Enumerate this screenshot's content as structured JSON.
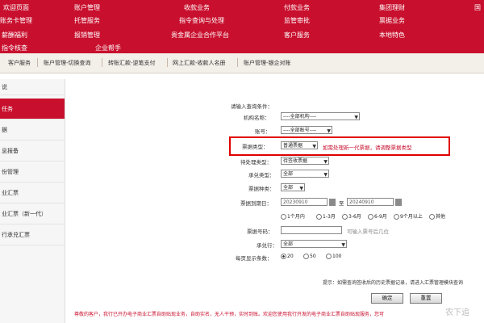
{
  "top_nav": {
    "row1": [
      "欢迎页面",
      "账户管理",
      "收款业务",
      "付款业务",
      "集团理财",
      "国"
    ],
    "row2": [
      "账务卡管理",
      "托管服务",
      "指令查询与处理",
      "监管审批",
      "票据业务"
    ],
    "row3": [
      "薪酬福利",
      "报销管理",
      "贵金属企业合作平台",
      "客户服务",
      "本地特色"
    ],
    "row4": [
      "指令核查",
      "企业帮手"
    ]
  },
  "sub_nav": [
    "客户服务",
    "账户管理-切换查询",
    "转账汇款-逆笔支付",
    "网上汇款-收款人名册",
    "账户管理-银企对账"
  ],
  "sidebar": [
    {
      "label": "说"
    },
    {
      "label": "任务",
      "active": true
    },
    {
      "label": "据"
    },
    {
      "label": "息报备"
    },
    {
      "label": "份管理"
    },
    {
      "label": "业汇票"
    },
    {
      "label": "业汇票（新一代）"
    },
    {
      "label": "行承兑汇票"
    }
  ],
  "form": {
    "section_label": "请输入查询条件：",
    "org": {
      "label": "机构名称：",
      "value": "----全部机构----"
    },
    "account": {
      "label": "账号：",
      "value": "----全部账号----"
    },
    "note_type": {
      "label": "票据类型：",
      "value": "普通票据"
    },
    "note_type_hint": "如需处理新一代票据，请调整票据类型",
    "pending_type": {
      "label": "待处理类型：",
      "value": "待签收票据"
    },
    "accept_type": {
      "label": "承兑类型：",
      "value": "全部"
    },
    "note_kind": {
      "label": "票据种类：",
      "value": "全部"
    },
    "due_date": {
      "label": "票据到期日：",
      "from": "20230910",
      "to_word": "至",
      "to": "20240910"
    },
    "period_options": [
      "1个月内",
      "1-3月",
      "3-6月",
      "6-9月",
      "9个月以上",
      "其他"
    ],
    "note_no": {
      "label": "票据号码：",
      "placeholder": "",
      "hint": "可输入票号后几位"
    },
    "acceptor": {
      "label": "承兑行：",
      "value": "全部"
    },
    "per_page": {
      "label": "每页显示条数：",
      "options": [
        "20",
        "50",
        "100"
      ],
      "selected": "20"
    }
  },
  "bottom_note": "提示：如需查询签收后的历史票据记录，请进入汇票管理模块查询",
  "buttons": {
    "confirm": "确定",
    "reset": "重置"
  },
  "footer": "尊敬的客户，我行已开办电子商业汇票自助贴现业务，自助实名，无人干预，实时到账。欢迎您使用我行开发的电子商业汇票自助贴现服务，您可",
  "watermark": "农下追"
}
